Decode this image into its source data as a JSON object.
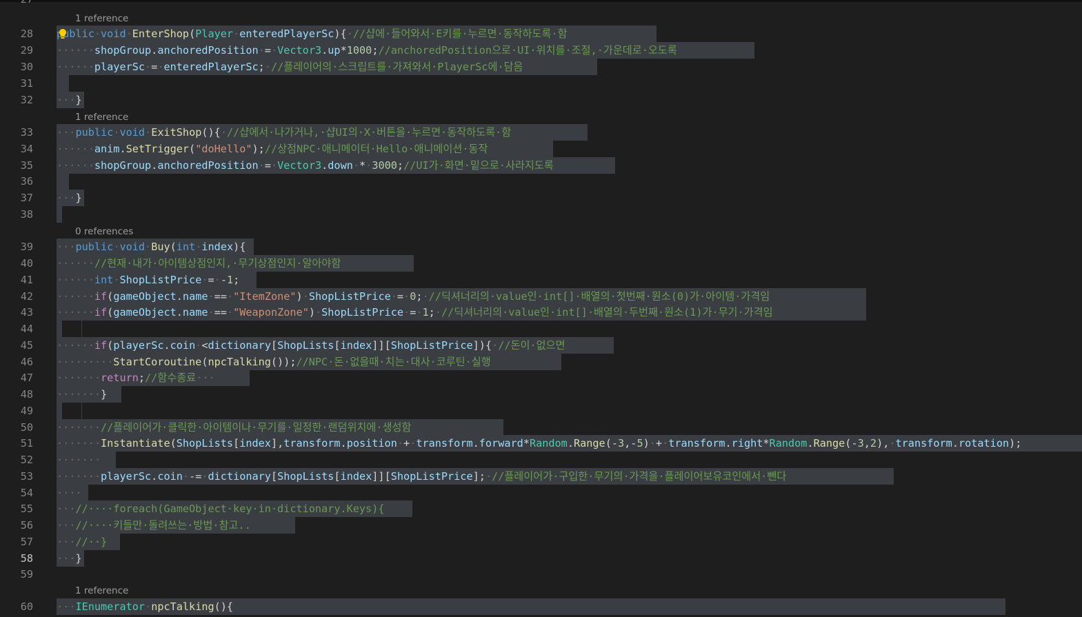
{
  "editor": {
    "active_line": 58,
    "top_partial_line": "27",
    "code_lens": [
      {
        "before_line": 28,
        "text": "1 reference"
      },
      {
        "before_line": 33,
        "text": "1 reference"
      },
      {
        "before_line": 39,
        "text": "0 references"
      },
      {
        "before_line": 60,
        "text": "1 reference"
      }
    ],
    "lines": [
      {
        "n": 28,
        "sel": 870,
        "tokens": [
          [
            "kw",
            "public"
          ],
          [
            "ws",
            "·"
          ],
          [
            "kw",
            "void"
          ],
          [
            "ws",
            "·"
          ],
          [
            "fn",
            "EnterShop"
          ],
          [
            "pn",
            "("
          ],
          [
            "ty",
            "Player"
          ],
          [
            "ws",
            "·"
          ],
          [
            "vr",
            "enteredPlayerSc"
          ],
          [
            "pn",
            "){"
          ],
          [
            "ws",
            "·"
          ],
          [
            "cm",
            "//샵에·들어와서·E키를·누르면·동작하도록·함"
          ]
        ]
      },
      {
        "n": 29,
        "sel": 1012,
        "tokens": [
          [
            "ws",
            "······"
          ],
          [
            "vr",
            "shopGroup"
          ],
          [
            "pn",
            "."
          ],
          [
            "vr",
            "anchoredPosition"
          ],
          [
            "ws",
            "·"
          ],
          [
            "pn",
            "="
          ],
          [
            "ws",
            "·"
          ],
          [
            "ty",
            "Vector3"
          ],
          [
            "pn",
            "."
          ],
          [
            "vr",
            "up"
          ],
          [
            "pn",
            "*"
          ],
          [
            "nm",
            "1000"
          ],
          [
            "pn",
            ";"
          ],
          [
            "cm",
            "//anchoredPosition으로·UI·위치를·조절,·가운데로·오도록"
          ]
        ]
      },
      {
        "n": 30,
        "sel": 784,
        "tokens": [
          [
            "ws",
            "······"
          ],
          [
            "vr",
            "playerSc"
          ],
          [
            "ws",
            "·"
          ],
          [
            "pn",
            "="
          ],
          [
            "ws",
            "·"
          ],
          [
            "vr",
            "enteredPlayerSc"
          ],
          [
            "pn",
            ";"
          ],
          [
            "ws",
            "·"
          ],
          [
            "cm",
            "//플레이어의·스크립트를·가져와서·PlayerSc에·담음"
          ]
        ]
      },
      {
        "n": 31,
        "sel": 18,
        "tokens": []
      },
      {
        "n": 32,
        "sel": 40,
        "tokens": [
          [
            "ws",
            "···"
          ],
          [
            "pn",
            "}"
          ]
        ]
      },
      {
        "n": 33,
        "sel": 770,
        "tokens": [
          [
            "ws",
            "···"
          ],
          [
            "kw",
            "public"
          ],
          [
            "ws",
            "·"
          ],
          [
            "kw",
            "void"
          ],
          [
            "ws",
            "·"
          ],
          [
            "fn",
            "ExitShop"
          ],
          [
            "pn",
            "(){"
          ],
          [
            "ws",
            "·"
          ],
          [
            "cm",
            "//샵에서·나가거나,·샵UI의·X·버튼을·누르면·동작하도록·함"
          ]
        ]
      },
      {
        "n": 34,
        "sel": 720,
        "tokens": [
          [
            "ws",
            "······"
          ],
          [
            "vr",
            "anim"
          ],
          [
            "pn",
            "."
          ],
          [
            "fn",
            "SetTrigger"
          ],
          [
            "pn",
            "("
          ],
          [
            "st",
            "\"doHello\""
          ],
          [
            "pn",
            ");"
          ],
          [
            "cm",
            "//상점NPC·애니메이터·Hello·애니메이션·동작"
          ]
        ]
      },
      {
        "n": 35,
        "sel": 810,
        "tokens": [
          [
            "ws",
            "······"
          ],
          [
            "vr",
            "shopGroup"
          ],
          [
            "pn",
            "."
          ],
          [
            "vr",
            "anchoredPosition"
          ],
          [
            "ws",
            "·"
          ],
          [
            "pn",
            "="
          ],
          [
            "ws",
            "·"
          ],
          [
            "ty",
            "Vector3"
          ],
          [
            "pn",
            "."
          ],
          [
            "vr",
            "down"
          ],
          [
            "ws",
            "·"
          ],
          [
            "pn",
            "*"
          ],
          [
            "ws",
            "·"
          ],
          [
            "nm",
            "3000"
          ],
          [
            "pn",
            ";"
          ],
          [
            "cm",
            "//UI가·화면·밑으로·사라지도록"
          ]
        ]
      },
      {
        "n": 36,
        "sel": 18,
        "tokens": []
      },
      {
        "n": 37,
        "sel": 40,
        "tokens": [
          [
            "ws",
            "···"
          ],
          [
            "pn",
            "}"
          ]
        ]
      },
      {
        "n": 38,
        "sel": 8,
        "tokens": []
      },
      {
        "n": 39,
        "sel": 286,
        "tokens": [
          [
            "ws",
            "···"
          ],
          [
            "kw",
            "public"
          ],
          [
            "ws",
            "·"
          ],
          [
            "kw",
            "void"
          ],
          [
            "ws",
            "·"
          ],
          [
            "fn",
            "Buy"
          ],
          [
            "pn",
            "("
          ],
          [
            "kw",
            "int"
          ],
          [
            "ws",
            "·"
          ],
          [
            "vr",
            "index"
          ],
          [
            "pn",
            "){"
          ]
        ]
      },
      {
        "n": 40,
        "sel": 518,
        "tokens": [
          [
            "ws",
            "······"
          ],
          [
            "cm",
            "//현재·내가·아이템상점인지,·무기상점인지·알아야함"
          ]
        ]
      },
      {
        "n": 41,
        "sel": 290,
        "tokens": [
          [
            "ws",
            "······"
          ],
          [
            "kw",
            "int"
          ],
          [
            "ws",
            "·"
          ],
          [
            "vr",
            "ShopListPrice"
          ],
          [
            "ws",
            "·"
          ],
          [
            "pn",
            "="
          ],
          [
            "ws",
            "·"
          ],
          [
            "pn",
            "-"
          ],
          [
            "nm",
            "1"
          ],
          [
            "pn",
            ";"
          ]
        ]
      },
      {
        "n": 42,
        "sel": 1174,
        "tokens": [
          [
            "ws",
            "······"
          ],
          [
            "ctl",
            "if"
          ],
          [
            "pn",
            "("
          ],
          [
            "vr",
            "gameObject"
          ],
          [
            "pn",
            "."
          ],
          [
            "vr",
            "name"
          ],
          [
            "ws",
            "·"
          ],
          [
            "pn",
            "=="
          ],
          [
            "ws",
            "·"
          ],
          [
            "st",
            "\"ItemZone\""
          ],
          [
            "pn",
            ")"
          ],
          [
            "ws",
            "·"
          ],
          [
            "vr",
            "ShopListPrice"
          ],
          [
            "ws",
            "·"
          ],
          [
            "pn",
            "="
          ],
          [
            "ws",
            "·"
          ],
          [
            "nm",
            "0"
          ],
          [
            "pn",
            ";"
          ],
          [
            "ws",
            "·"
          ],
          [
            "cm",
            "//딕셔너리의·value인·int[]·배열의·첫번째·원소(0)가·아이템·가격임"
          ]
        ]
      },
      {
        "n": 43,
        "sel": 1174,
        "tokens": [
          [
            "ws",
            "······"
          ],
          [
            "ctl",
            "if"
          ],
          [
            "pn",
            "("
          ],
          [
            "vr",
            "gameObject"
          ],
          [
            "pn",
            "."
          ],
          [
            "vr",
            "name"
          ],
          [
            "ws",
            "·"
          ],
          [
            "pn",
            "=="
          ],
          [
            "ws",
            "·"
          ],
          [
            "st",
            "\"WeaponZone\""
          ],
          [
            "pn",
            ")"
          ],
          [
            "ws",
            "·"
          ],
          [
            "vr",
            "ShopListPrice"
          ],
          [
            "ws",
            "·"
          ],
          [
            "pn",
            "="
          ],
          [
            "ws",
            "·"
          ],
          [
            "nm",
            "1"
          ],
          [
            "pn",
            ";"
          ],
          [
            "ws",
            "·"
          ],
          [
            "cm",
            "//딕셔너리의·value인·int[]·배열의·두번째·원소(1)가·무기·가격임"
          ]
        ]
      },
      {
        "n": 44,
        "sel": 8,
        "tokens": []
      },
      {
        "n": 45,
        "sel": 808,
        "tokens": [
          [
            "ws",
            "······"
          ],
          [
            "ctl",
            "if"
          ],
          [
            "pn",
            "("
          ],
          [
            "vr",
            "playerSc"
          ],
          [
            "pn",
            "."
          ],
          [
            "vr",
            "coin"
          ],
          [
            "ws",
            "·"
          ],
          [
            "pn",
            "<"
          ],
          [
            "vr",
            "dictionary"
          ],
          [
            "pn",
            "["
          ],
          [
            "vr",
            "ShopLists"
          ],
          [
            "pn",
            "["
          ],
          [
            "vr",
            "index"
          ],
          [
            "pn",
            "]]["
          ],
          [
            "vr",
            "ShopListPrice"
          ],
          [
            "pn",
            "]){"
          ],
          [
            "ws",
            "·"
          ],
          [
            "cm",
            "//돈이·없으면"
          ]
        ]
      },
      {
        "n": 46,
        "sel": 732,
        "tokens": [
          [
            "ws",
            "·········"
          ],
          [
            "fn",
            "StartCoroutine"
          ],
          [
            "pn",
            "("
          ],
          [
            "fn",
            "npcTalking"
          ],
          [
            "pn",
            "());"
          ],
          [
            "cm",
            "//NPC·돈·없을때·치는·대사·코루틴·실행"
          ]
        ]
      },
      {
        "n": 47,
        "sel": 280,
        "tokens": [
          [
            "ws",
            "·······"
          ],
          [
            "ctl",
            "return"
          ],
          [
            "pn",
            ";"
          ],
          [
            "cm",
            "//함수종료"
          ],
          [
            "ws",
            "···"
          ]
        ]
      },
      {
        "n": 48,
        "sel": 94,
        "tokens": [
          [
            "ws",
            "·······"
          ],
          [
            "pn",
            "}"
          ]
        ]
      },
      {
        "n": 49,
        "sel": 8,
        "tokens": []
      },
      {
        "n": 50,
        "sel": 648,
        "tokens": [
          [
            "ws",
            "·······"
          ],
          [
            "cm",
            "//플레이어가·클릭한·아이템이나·무기를·일정한·랜덤위치에·생성함"
          ]
        ]
      },
      {
        "n": 51,
        "sel": 1487,
        "tokens": [
          [
            "ws",
            "·······"
          ],
          [
            "fn",
            "Instantiate"
          ],
          [
            "pn",
            "("
          ],
          [
            "vr",
            "ShopLists"
          ],
          [
            "pn",
            "["
          ],
          [
            "vr",
            "index"
          ],
          [
            "pn",
            "],"
          ],
          [
            "vr",
            "transform"
          ],
          [
            "pn",
            "."
          ],
          [
            "vr",
            "position"
          ],
          [
            "ws",
            "·"
          ],
          [
            "pn",
            "+"
          ],
          [
            "ws",
            "·"
          ],
          [
            "vr",
            "transform"
          ],
          [
            "pn",
            "."
          ],
          [
            "vr",
            "forward"
          ],
          [
            "pn",
            "*"
          ],
          [
            "ty",
            "Random"
          ],
          [
            "pn",
            "."
          ],
          [
            "fn",
            "Range"
          ],
          [
            "pn",
            "(-"
          ],
          [
            "nm",
            "3"
          ],
          [
            "pn",
            ",-"
          ],
          [
            "nm",
            "5"
          ],
          [
            "pn",
            ")"
          ],
          [
            "ws",
            "·"
          ],
          [
            "pn",
            "+"
          ],
          [
            "ws",
            "·"
          ],
          [
            "vr",
            "transform"
          ],
          [
            "pn",
            "."
          ],
          [
            "vr",
            "right"
          ],
          [
            "pn",
            "*"
          ],
          [
            "ty",
            "Random"
          ],
          [
            "pn",
            "."
          ],
          [
            "fn",
            "Range"
          ],
          [
            "pn",
            "(-"
          ],
          [
            "nm",
            "3"
          ],
          [
            "pn",
            ","
          ],
          [
            "nm",
            "2"
          ],
          [
            "pn",
            "),"
          ],
          [
            "ws",
            "·"
          ],
          [
            "vr",
            "transform"
          ],
          [
            "pn",
            "."
          ],
          [
            "vr",
            "rotation"
          ],
          [
            "pn",
            ");"
          ]
        ]
      },
      {
        "n": 52,
        "sel": 86,
        "tokens": [
          [
            "ws",
            "·······"
          ]
        ]
      },
      {
        "n": 53,
        "sel": 1214,
        "tokens": [
          [
            "ws",
            "·······"
          ],
          [
            "vr",
            "playerSc"
          ],
          [
            "pn",
            "."
          ],
          [
            "vr",
            "coin"
          ],
          [
            "ws",
            "·"
          ],
          [
            "pn",
            "-="
          ],
          [
            "ws",
            "·"
          ],
          [
            "vr",
            "dictionary"
          ],
          [
            "pn",
            "["
          ],
          [
            "vr",
            "ShopLists"
          ],
          [
            "pn",
            "["
          ],
          [
            "vr",
            "index"
          ],
          [
            "pn",
            "]]["
          ],
          [
            "vr",
            "ShopListPrice"
          ],
          [
            "pn",
            "];"
          ],
          [
            "ws",
            "·"
          ],
          [
            "cm",
            "//플레이어가·구입한·무기의·가격을·플레이어보유코인에서·뺀다"
          ]
        ]
      },
      {
        "n": 54,
        "sel": 46,
        "tokens": [
          [
            "ws",
            "····"
          ]
        ]
      },
      {
        "n": 55,
        "sel": 516,
        "tokens": [
          [
            "ws",
            "···"
          ],
          [
            "cm",
            "//····foreach(GameObject·key·in·dictionary.Keys){"
          ]
        ]
      },
      {
        "n": 56,
        "sel": 346,
        "tokens": [
          [
            "ws",
            "···"
          ],
          [
            "cm",
            "//····키들만·돌려쓰는·방법·참고.."
          ]
        ]
      },
      {
        "n": 57,
        "sel": 92,
        "tokens": [
          [
            "ws",
            "···"
          ],
          [
            "cm",
            "//··}"
          ]
        ]
      },
      {
        "n": 58,
        "sel": 40,
        "tokens": [
          [
            "ws",
            "···"
          ],
          [
            "pn",
            "}"
          ]
        ]
      },
      {
        "n": 59,
        "sel": 0,
        "tokens": []
      },
      {
        "n": 60,
        "sel": 1376,
        "tokens": [
          [
            "ws",
            "···"
          ],
          [
            "ty",
            "IEnumerator"
          ],
          [
            "ws",
            "·"
          ],
          [
            "fn",
            "npcTalking"
          ],
          [
            "pn",
            "(){"
          ]
        ]
      }
    ]
  },
  "icons": {
    "lightbulb": {
      "name": "lightbulb-icon",
      "color": "#ffcc00",
      "line": 28
    }
  },
  "colors": {
    "background": "#1e1e1e",
    "selection": "#3a3d41",
    "keyword": "#569cd6",
    "control": "#c586c0",
    "type": "#4ec9b0",
    "function": "#dcdcaa",
    "variable": "#9cdcfe",
    "string": "#ce9178",
    "number": "#b5cea8",
    "comment": "#6a9955"
  }
}
